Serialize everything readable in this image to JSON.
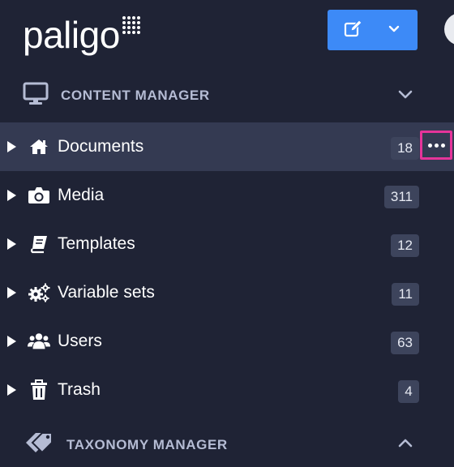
{
  "brand": {
    "logo_text": "paligo"
  },
  "header": {
    "edit_button_icon": "edit-icon",
    "edit_dropdown_icon": "chevron-down-icon"
  },
  "content_manager": {
    "title": "CONTENT MANAGER",
    "icon": "monitor-icon",
    "expanded": true,
    "items": [
      {
        "label": "Documents",
        "count": "18",
        "icon": "home-icon",
        "active": true
      },
      {
        "label": "Media",
        "count": "311",
        "icon": "camera-icon"
      },
      {
        "label": "Templates",
        "count": "12",
        "icon": "book-icon"
      },
      {
        "label": "Variable sets",
        "count": "11",
        "icon": "gears-icon"
      },
      {
        "label": "Users",
        "count": "63",
        "icon": "users-icon"
      },
      {
        "label": "Trash",
        "count": "4",
        "icon": "trash-icon"
      }
    ]
  },
  "taxonomy_manager": {
    "title": "TAXONOMY MANAGER",
    "icon": "tags-icon",
    "expanded": false
  },
  "colors": {
    "background": "#1f2335",
    "active_row": "#343a52",
    "accent": "#3d8af7",
    "highlight": "#e5349a"
  }
}
